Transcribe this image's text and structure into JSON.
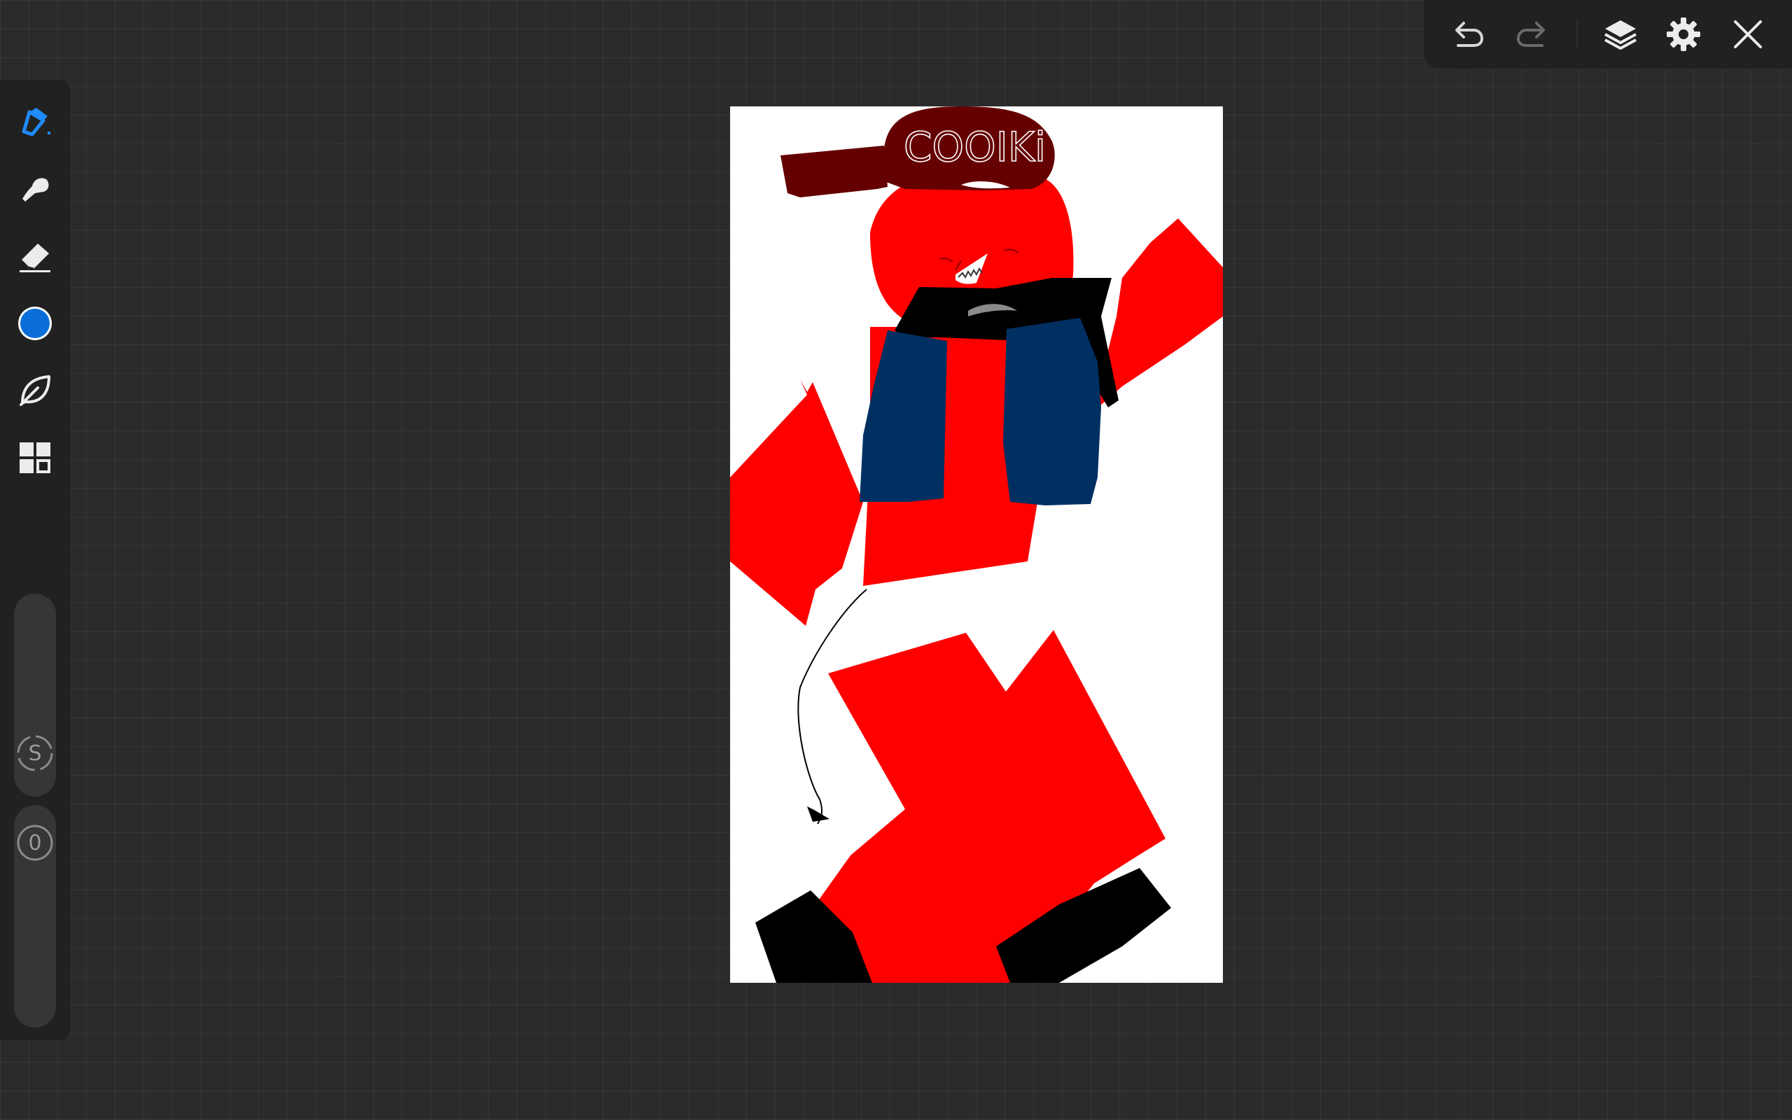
{
  "app": {
    "accent_color": "#1f8bff",
    "current_color": "#0a6ed8"
  },
  "left_toolbar": {
    "tools": [
      {
        "name": "pen",
        "icon": "pen-nib-icon",
        "active": true
      },
      {
        "name": "smudge",
        "icon": "smudge-finger-icon"
      },
      {
        "name": "eraser",
        "icon": "eraser-icon"
      },
      {
        "name": "color",
        "icon": "color-swatch-icon"
      },
      {
        "name": "adjustments",
        "icon": "leaf-icon"
      },
      {
        "name": "gallery",
        "icon": "grid-icon"
      }
    ],
    "size_slider_label": "S",
    "opacity_slider_label": "0"
  },
  "top_toolbar": {
    "buttons": [
      {
        "name": "undo",
        "icon": "undo-icon"
      },
      {
        "name": "redo",
        "icon": "redo-icon",
        "disabled": true
      },
      {
        "name": "layers",
        "icon": "layers-icon"
      },
      {
        "name": "settings",
        "icon": "gear-icon"
      },
      {
        "name": "close",
        "icon": "close-icon"
      }
    ]
  },
  "artwork": {
    "cap_text": "COOIKi",
    "palette": {
      "skin": "#ff0000",
      "cap": "#650000",
      "vest": "#003062",
      "scarf": "#000000",
      "background": "#ffffff"
    }
  }
}
